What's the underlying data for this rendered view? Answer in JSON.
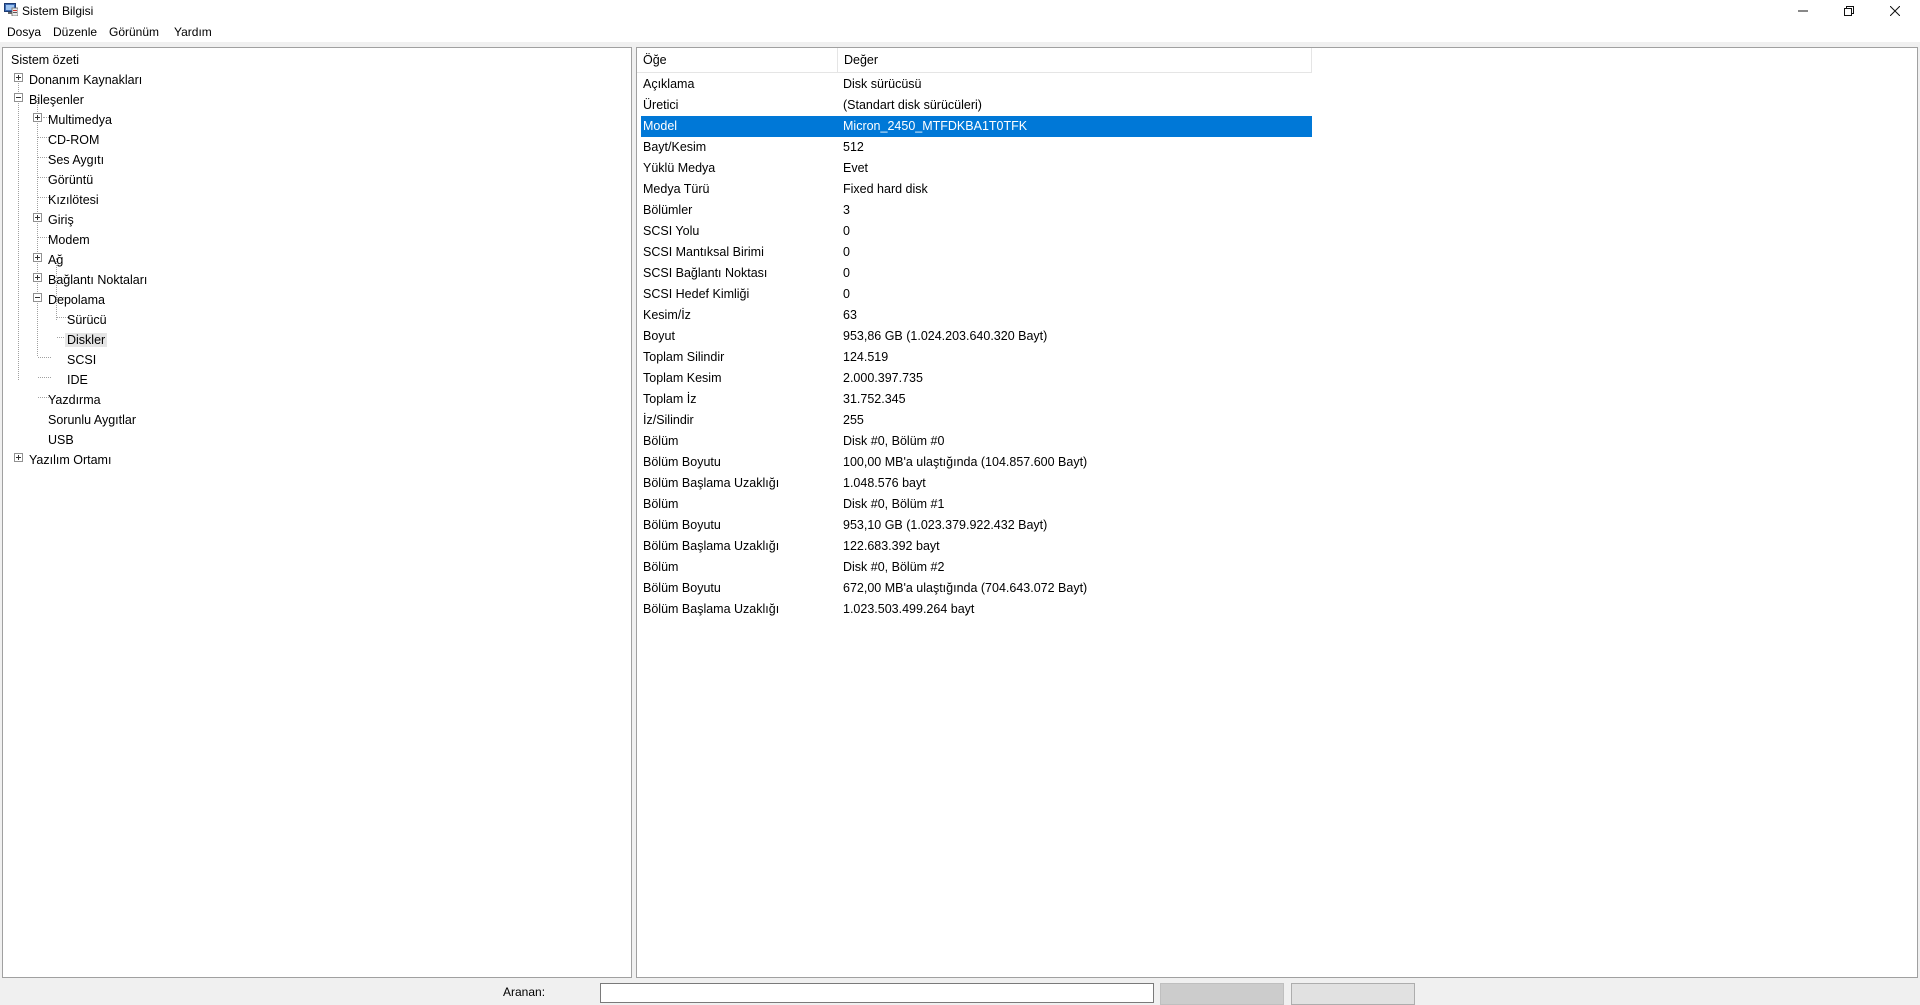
{
  "window": {
    "title": "Sistem Bilgisi"
  },
  "menu": [
    "Dosya",
    "Düzenle",
    "Görünüm",
    "Yardım"
  ],
  "tree": {
    "root": "Sistem özeti",
    "donanim": "Donanım Kaynakları",
    "bilesenler": "Bileşenler",
    "multimedya": "Multimedya",
    "cdrom": "CD-ROM",
    "ses": "Ses Aygıtı",
    "goruntu": "Görüntü",
    "kizilotesi": "Kızılötesi",
    "giris": "Giriş",
    "modem": "Modem",
    "ag": "Ağ",
    "baglanti": "Bağlantı Noktaları",
    "depolama": "Depolama",
    "surucu": "Sürücü",
    "diskler": "Diskler",
    "scsi": "SCSI",
    "ide": "IDE",
    "yazdirma": "Yazdırma",
    "sorunlu": "Sorunlu Aygıtlar",
    "usb": "USB",
    "yazilim": "Yazılım Ortamı"
  },
  "table": {
    "headers": [
      "Öğe",
      "Değer"
    ],
    "selected_row": 2,
    "rows": [
      [
        "Açıklama",
        "Disk sürücüsü"
      ],
      [
        "Üretici",
        "(Standart disk sürücüleri)"
      ],
      [
        "Model",
        "Micron_2450_MTFDKBA1T0TFK"
      ],
      [
        "Bayt/Kesim",
        "512"
      ],
      [
        "Yüklü Medya",
        "Evet"
      ],
      [
        "Medya Türü",
        "Fixed hard disk"
      ],
      [
        "Bölümler",
        "3"
      ],
      [
        "SCSI Yolu",
        "0"
      ],
      [
        "SCSI Mantıksal Birimi",
        "0"
      ],
      [
        "SCSI Bağlantı Noktası",
        "0"
      ],
      [
        "SCSI Hedef Kimliği",
        "0"
      ],
      [
        "Kesim/İz",
        "63"
      ],
      [
        "Boyut",
        "953,86 GB (1.024.203.640.320 Bayt)"
      ],
      [
        "Toplam Silindir",
        "124.519"
      ],
      [
        "Toplam Kesim",
        "2.000.397.735"
      ],
      [
        "Toplam İz",
        "31.752.345"
      ],
      [
        "İz/Silindir",
        "255"
      ],
      [
        "Bölüm",
        "Disk #0, Bölüm #0"
      ],
      [
        "Bölüm Boyutu",
        "100,00 MB'a ulaştığında (104.857.600 Bayt)"
      ],
      [
        "Bölüm Başlama Uzaklığı",
        "1.048.576 bayt"
      ],
      [
        "Bölüm",
        "Disk #0, Bölüm #1"
      ],
      [
        "Bölüm Boyutu",
        "953,10 GB (1.023.379.922.432 Bayt)"
      ],
      [
        "Bölüm Başlama Uzaklığı",
        "122.683.392 bayt"
      ],
      [
        "Bölüm",
        "Disk #0, Bölüm #2"
      ],
      [
        "Bölüm Boyutu",
        "672,00 MB'a ulaştığında (704.643.072 Bayt)"
      ],
      [
        "Bölüm Başlama Uzaklığı",
        "1.023.503.499.264 bayt"
      ]
    ]
  },
  "find": {
    "label": "Aranan:",
    "value": ""
  },
  "icons": {
    "app": "system-information-icon",
    "minimize": "minimize-icon",
    "restore": "restore-icon",
    "close": "close-icon"
  },
  "colors": {
    "selection": "#0078d7",
    "tree_selection": "#e5e5e5"
  }
}
